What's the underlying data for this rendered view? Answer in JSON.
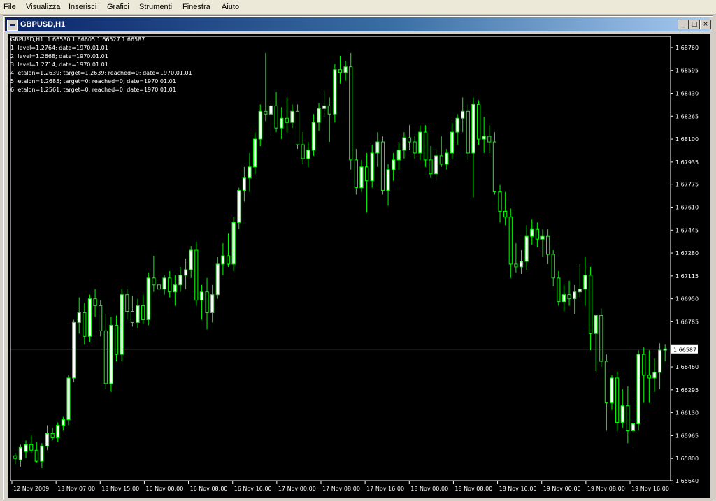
{
  "menu": [
    "File",
    "Visualizza",
    "Inserisci",
    "Grafici",
    "Strumenti",
    "Finestra",
    "Aiuto"
  ],
  "window": {
    "title": "GBPUSD,H1",
    "buttons": [
      "minimize",
      "maximize",
      "close"
    ]
  },
  "chart_header": {
    "symbol_line": "GBPUSD,H1  1.66580 1.66605 1.66527 1.66587",
    "indicator_lines": [
      "1: level=1.2764; date=1970.01.01",
      "2: level=1.2668; date=1970.01.01",
      "3: level=1.2714; date=1970.01.01",
      "4: etalon=1.2639; target=1.2639; reached=0; date=1970.01.01",
      "5: etalon=1.2685; target=0; reached=0; date=1970.01.01",
      "6: etalon=1.2561; target=0; reached=0; date=1970.01.01"
    ]
  },
  "colors": {
    "background": "#000000",
    "candle_up": "#ffffff",
    "candle_down": "#000000",
    "wick": "#00ff00",
    "grid_text": "#ffffff",
    "bid_line": "#c0c0c0"
  },
  "chart_data": {
    "type": "candlestick",
    "ylim": [
      1.6564,
      1.6884
    ],
    "yticks": [
      "1.68760",
      "1.68595",
      "1.68430",
      "1.68265",
      "1.68100",
      "1.67935",
      "1.67775",
      "1.67610",
      "1.67445",
      "1.67280",
      "1.67115",
      "1.66950",
      "1.66785",
      "1.66625",
      "1.66460",
      "1.66295",
      "1.66130",
      "1.65965",
      "1.65800",
      "1.65640"
    ],
    "xticks": [
      "12 Nov 2009",
      "13 Nov 07:00",
      "13 Nov 15:00",
      "16 Nov 00:00",
      "16 Nov 08:00",
      "16 Nov 16:00",
      "17 Nov 00:00",
      "17 Nov 08:00",
      "17 Nov 16:00",
      "18 Nov 00:00",
      "18 Nov 08:00",
      "18 Nov 16:00",
      "19 Nov 00:00",
      "19 Nov 08:00",
      "19 Nov 16:00"
    ],
    "current_price": "1.66587",
    "current_price_value": 1.66587,
    "candles": [
      [
        1.6582,
        1.6584,
        1.6576,
        1.658
      ],
      [
        1.6579,
        1.659,
        1.6574,
        1.6588
      ],
      [
        1.6585,
        1.6593,
        1.658,
        1.659
      ],
      [
        1.659,
        1.6597,
        1.6584,
        1.6586
      ],
      [
        1.6586,
        1.6592,
        1.6577,
        1.6578
      ],
      [
        1.6578,
        1.6591,
        1.6573,
        1.6589
      ],
      [
        1.6589,
        1.6604,
        1.6586,
        1.6598
      ],
      [
        1.6598,
        1.6602,
        1.6593,
        1.6595
      ],
      [
        1.6595,
        1.6606,
        1.6592,
        1.6604
      ],
      [
        1.6604,
        1.661,
        1.66,
        1.6608
      ],
      [
        1.6608,
        1.664,
        1.6604,
        1.6638
      ],
      [
        1.6638,
        1.668,
        1.6635,
        1.6678
      ],
      [
        1.6678,
        1.6696,
        1.667,
        1.6685
      ],
      [
        1.6685,
        1.6692,
        1.6662,
        1.6668
      ],
      [
        1.6668,
        1.6698,
        1.6664,
        1.6695
      ],
      [
        1.6695,
        1.6702,
        1.6682,
        1.669
      ],
      [
        1.669,
        1.6694,
        1.6668,
        1.6672
      ],
      [
        1.6672,
        1.6684,
        1.663,
        1.6634
      ],
      [
        1.6634,
        1.6682,
        1.6628,
        1.6676
      ],
      [
        1.6676,
        1.6683,
        1.665,
        1.6655
      ],
      [
        1.6655,
        1.6702,
        1.665,
        1.6698
      ],
      [
        1.6698,
        1.6702,
        1.668,
        1.6686
      ],
      [
        1.6686,
        1.6697,
        1.6675,
        1.6678
      ],
      [
        1.6678,
        1.6695,
        1.6674,
        1.669
      ],
      [
        1.669,
        1.6698,
        1.6677,
        1.668
      ],
      [
        1.668,
        1.6714,
        1.6676,
        1.671
      ],
      [
        1.671,
        1.6726,
        1.67,
        1.6705
      ],
      [
        1.6705,
        1.6712,
        1.6697,
        1.6702
      ],
      [
        1.6702,
        1.6712,
        1.6698,
        1.671
      ],
      [
        1.671,
        1.6715,
        1.6696,
        1.67
      ],
      [
        1.67,
        1.6712,
        1.669,
        1.6705
      ],
      [
        1.6705,
        1.6718,
        1.67,
        1.6712
      ],
      [
        1.6712,
        1.6724,
        1.6702,
        1.6716
      ],
      [
        1.6716,
        1.6733,
        1.671,
        1.673
      ],
      [
        1.673,
        1.6736,
        1.669,
        1.6694
      ],
      [
        1.6694,
        1.6705,
        1.668,
        1.67
      ],
      [
        1.67,
        1.671,
        1.6673,
        1.6685
      ],
      [
        1.6685,
        1.6705,
        1.6678,
        1.6698
      ],
      [
        1.6698,
        1.6725,
        1.6695,
        1.672
      ],
      [
        1.672,
        1.6735,
        1.6712,
        1.6726
      ],
      [
        1.6726,
        1.6742,
        1.6718,
        1.672
      ],
      [
        1.672,
        1.6754,
        1.6715,
        1.675
      ],
      [
        1.675,
        1.6775,
        1.6745,
        1.6773
      ],
      [
        1.6773,
        1.679,
        1.6765,
        1.6782
      ],
      [
        1.6782,
        1.68,
        1.6772,
        1.679
      ],
      [
        1.679,
        1.6815,
        1.6785,
        1.681
      ],
      [
        1.681,
        1.6835,
        1.6805,
        1.683
      ],
      [
        1.683,
        1.6872,
        1.6823,
        1.6828
      ],
      [
        1.6828,
        1.6836,
        1.6812,
        1.6834
      ],
      [
        1.6834,
        1.6844,
        1.6815,
        1.6818
      ],
      [
        1.6818,
        1.6833,
        1.681,
        1.6825
      ],
      [
        1.6825,
        1.684,
        1.6815,
        1.6822
      ],
      [
        1.6822,
        1.6835,
        1.6818,
        1.683
      ],
      [
        1.683,
        1.6835,
        1.6803,
        1.6806
      ],
      [
        1.6806,
        1.6815,
        1.6792,
        1.6796
      ],
      [
        1.6796,
        1.6808,
        1.679,
        1.6802
      ],
      [
        1.6802,
        1.6828,
        1.6798,
        1.6822
      ],
      [
        1.6822,
        1.6836,
        1.6816,
        1.6832
      ],
      [
        1.6832,
        1.6845,
        1.6826,
        1.6834
      ],
      [
        1.6834,
        1.684,
        1.6808,
        1.6828
      ],
      [
        1.6828,
        1.6864,
        1.6822,
        1.686
      ],
      [
        1.686,
        1.687,
        1.685,
        1.6858
      ],
      [
        1.6858,
        1.6866,
        1.6852,
        1.6862
      ],
      [
        1.6862,
        1.6872,
        1.6788,
        1.6795
      ],
      [
        1.6795,
        1.6803,
        1.677,
        1.6775
      ],
      [
        1.6775,
        1.6795,
        1.6772,
        1.679
      ],
      [
        1.679,
        1.68,
        1.6757,
        1.678
      ],
      [
        1.678,
        1.6806,
        1.6775,
        1.68
      ],
      [
        1.68,
        1.6815,
        1.679,
        1.6808
      ],
      [
        1.6808,
        1.6812,
        1.677,
        1.6773
      ],
      [
        1.6773,
        1.6792,
        1.6762,
        1.6788
      ],
      [
        1.6788,
        1.68,
        1.678,
        1.6795
      ],
      [
        1.6795,
        1.6808,
        1.6788,
        1.6802
      ],
      [
        1.6802,
        1.6815,
        1.6796,
        1.6811
      ],
      [
        1.6811,
        1.682,
        1.6802,
        1.6808
      ],
      [
        1.6808,
        1.6812,
        1.6796,
        1.68
      ],
      [
        1.68,
        1.682,
        1.6795,
        1.6815
      ],
      [
        1.6815,
        1.682,
        1.679,
        1.6795
      ],
      [
        1.6795,
        1.6805,
        1.6782,
        1.6785
      ],
      [
        1.6785,
        1.6803,
        1.678,
        1.6798
      ],
      [
        1.6798,
        1.6812,
        1.679,
        1.6792
      ],
      [
        1.6792,
        1.6803,
        1.6788,
        1.68
      ],
      [
        1.68,
        1.6822,
        1.6796,
        1.6815
      ],
      [
        1.6815,
        1.6828,
        1.6806,
        1.6825
      ],
      [
        1.6825,
        1.684,
        1.6815,
        1.683
      ],
      [
        1.683,
        1.6835,
        1.6795,
        1.68
      ],
      [
        1.68,
        1.684,
        1.6768,
        1.6835
      ],
      [
        1.6835,
        1.6838,
        1.6806,
        1.681
      ],
      [
        1.681,
        1.6826,
        1.68,
        1.6812
      ],
      [
        1.6812,
        1.682,
        1.68,
        1.6808
      ],
      [
        1.6808,
        1.6815,
        1.677,
        1.6772
      ],
      [
        1.6772,
        1.6777,
        1.675,
        1.6758
      ],
      [
        1.6758,
        1.6772,
        1.6748,
        1.6754
      ],
      [
        1.6754,
        1.676,
        1.671,
        1.672
      ],
      [
        1.672,
        1.6735,
        1.6714,
        1.6718
      ],
      [
        1.6718,
        1.673,
        1.6713,
        1.6722
      ],
      [
        1.6722,
        1.6748,
        1.6716,
        1.674
      ],
      [
        1.674,
        1.6752,
        1.6734,
        1.6745
      ],
      [
        1.6745,
        1.675,
        1.6732,
        1.6738
      ],
      [
        1.6738,
        1.6745,
        1.6725,
        1.674
      ],
      [
        1.674,
        1.6745,
        1.672,
        1.6727
      ],
      [
        1.6727,
        1.673,
        1.6704,
        1.671
      ],
      [
        1.671,
        1.6715,
        1.669,
        1.6693
      ],
      [
        1.6693,
        1.6705,
        1.6686,
        1.6698
      ],
      [
        1.6698,
        1.6708,
        1.669,
        1.6695
      ],
      [
        1.6695,
        1.6705,
        1.6684,
        1.67
      ],
      [
        1.67,
        1.672,
        1.6696,
        1.6702
      ],
      [
        1.6702,
        1.6725,
        1.669,
        1.6712
      ],
      [
        1.6712,
        1.6718,
        1.6658,
        1.667
      ],
      [
        1.667,
        1.668,
        1.6643,
        1.6683
      ],
      [
        1.6683,
        1.6688,
        1.6646,
        1.665
      ],
      [
        1.665,
        1.6655,
        1.66,
        1.662
      ],
      [
        1.662,
        1.664,
        1.6615,
        1.6638
      ],
      [
        1.6638,
        1.6643,
        1.66,
        1.6606
      ],
      [
        1.6606,
        1.663,
        1.6602,
        1.6618
      ],
      [
        1.6618,
        1.6632,
        1.6591,
        1.66
      ],
      [
        1.66,
        1.6622,
        1.6588,
        1.6605
      ],
      [
        1.6605,
        1.6658,
        1.66,
        1.6655
      ],
      [
        1.6655,
        1.666,
        1.662,
        1.664
      ],
      [
        1.664,
        1.6658,
        1.662,
        1.6638
      ],
      [
        1.6638,
        1.6652,
        1.6628,
        1.6642
      ],
      [
        1.6642,
        1.6663,
        1.663,
        1.6658
      ],
      [
        1.6658,
        1.6662,
        1.665,
        1.6659
      ]
    ]
  }
}
